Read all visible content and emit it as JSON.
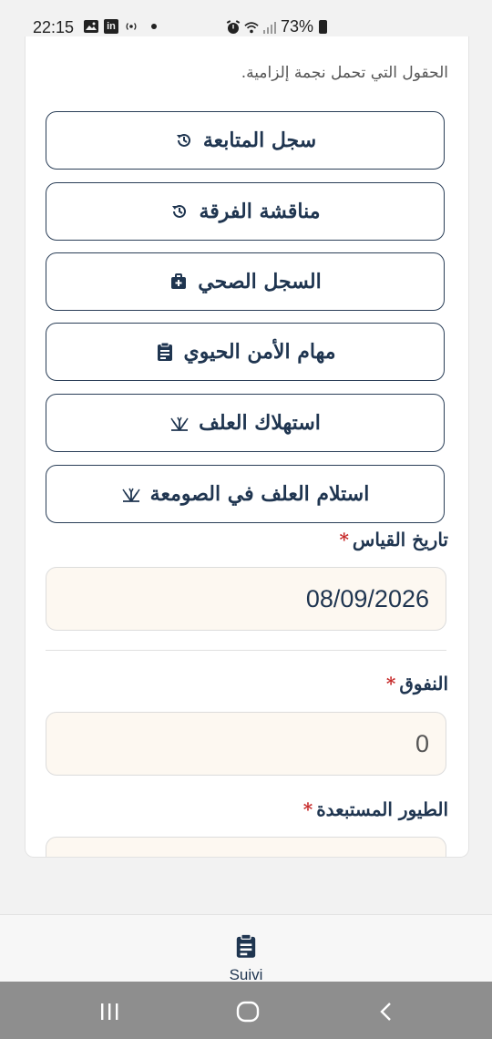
{
  "status_bar": {
    "time": "22:15",
    "left_icons": [
      "image-icon",
      "linkedin-icon",
      "broadcast-icon",
      "dot-icon"
    ],
    "right_icons": [
      "alarm-icon",
      "wifi-icon",
      "signal-icon"
    ],
    "battery_text": "73%"
  },
  "form": {
    "required_note": "الحقول التي تحمل نجمة إلزامية.",
    "menu": [
      {
        "label": "سجل المتابعة",
        "icon": "history-icon"
      },
      {
        "label": "مناقشة الفرقة",
        "icon": "history-icon"
      },
      {
        "label": "السجل الصحي",
        "icon": "medkit-icon"
      },
      {
        "label": "مهام الأمن الحيوي",
        "icon": "clipboard-icon"
      },
      {
        "label": "استهلاك العلف",
        "icon": "grain-icon"
      },
      {
        "label": "استلام العلف في الصومعة",
        "icon": "grain-icon"
      }
    ],
    "fields": {
      "measure_date": {
        "label": "تاريخ القياس",
        "required": "*",
        "value": "08/09/2026"
      },
      "mortality": {
        "label": "النفوق",
        "required": "*",
        "value": "0"
      },
      "culled_birds": {
        "label": "الطيور المستبعدة",
        "required": "*",
        "value": ""
      }
    }
  },
  "bottom_nav": {
    "label": "Suivi",
    "icon": "clipboard-icon"
  },
  "system_nav": {
    "buttons": [
      "recents-icon",
      "home-icon",
      "back-icon"
    ]
  },
  "colors": {
    "primary": "#1f3550",
    "required": "#c62828",
    "input_bg": "#fdf8f1"
  }
}
